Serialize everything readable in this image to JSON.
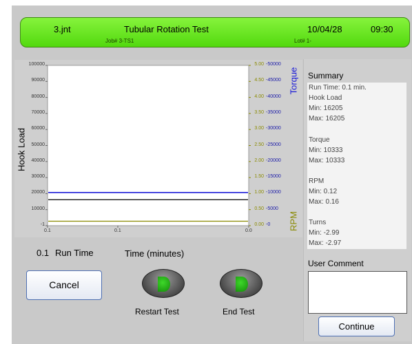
{
  "header": {
    "filename": "3.jnt",
    "title": "Tubular Rotation Test",
    "date": "10/04/28",
    "time": "09:30",
    "job": "Job# 3-TS1",
    "lot": "Lot# 1-"
  },
  "chart_data": {
    "type": "line",
    "ylabel": "Hook Load",
    "torque_label": "Torque",
    "rpm_label": "RPM",
    "x_ticks": [
      "0.1",
      "0.1",
      "0.0"
    ],
    "ylim": [
      -1,
      100000
    ],
    "y_ticks": [
      "100000",
      "90000",
      "80000",
      "70000",
      "60000",
      "50000",
      "40000",
      "30000",
      "20000",
      "10000",
      "-1"
    ],
    "rpm_ticks": [
      "5.00",
      "4.50",
      "4.00",
      "3.50",
      "3.00",
      "2.50",
      "2.00",
      "1.50",
      "1.00",
      "0.50",
      "0.00"
    ],
    "torque_ticks": [
      "50000",
      "45000",
      "40000",
      "35000",
      "30000",
      "25000",
      "20000",
      "15000",
      "10000",
      "5000",
      "0"
    ],
    "series": [
      {
        "name": "Hook Load",
        "axis": "left",
        "y": 16205
      },
      {
        "name": "Torque",
        "axis": "torque",
        "y": 10333
      },
      {
        "name": "RPM",
        "axis": "rpm",
        "y": 0.14
      }
    ]
  },
  "runtime": {
    "value": "0.1",
    "label": "Run Time"
  },
  "xlabel": "Time (minutes)",
  "buttons": {
    "cancel": "Cancel",
    "restart": "Restart Test",
    "end": "End Test",
    "continue": "Continue"
  },
  "summary": {
    "title": "Summary",
    "run_time": "Run Time: 0.1 min.",
    "hook_title": "Hook Load",
    "hook_min": "Min: 16205",
    "hook_max": "Max: 16205",
    "torque_title": "Torque",
    "torque_min": "Min: 10333",
    "torque_max": "Max: 10333",
    "rpm_title": "RPM",
    "rpm_min": "Min: 0.12",
    "rpm_max": "Max: 0.16",
    "turns_title": "Turns",
    "turns_min": "Min: -2.99",
    "turns_max": "Max: -2.97"
  },
  "user_comment": {
    "label": "User Comment",
    "value": ""
  },
  "colors": {
    "header": "#5fe018",
    "torque": "#1a1ad8",
    "rpm": "#8a8a00",
    "hook": "#000000"
  }
}
